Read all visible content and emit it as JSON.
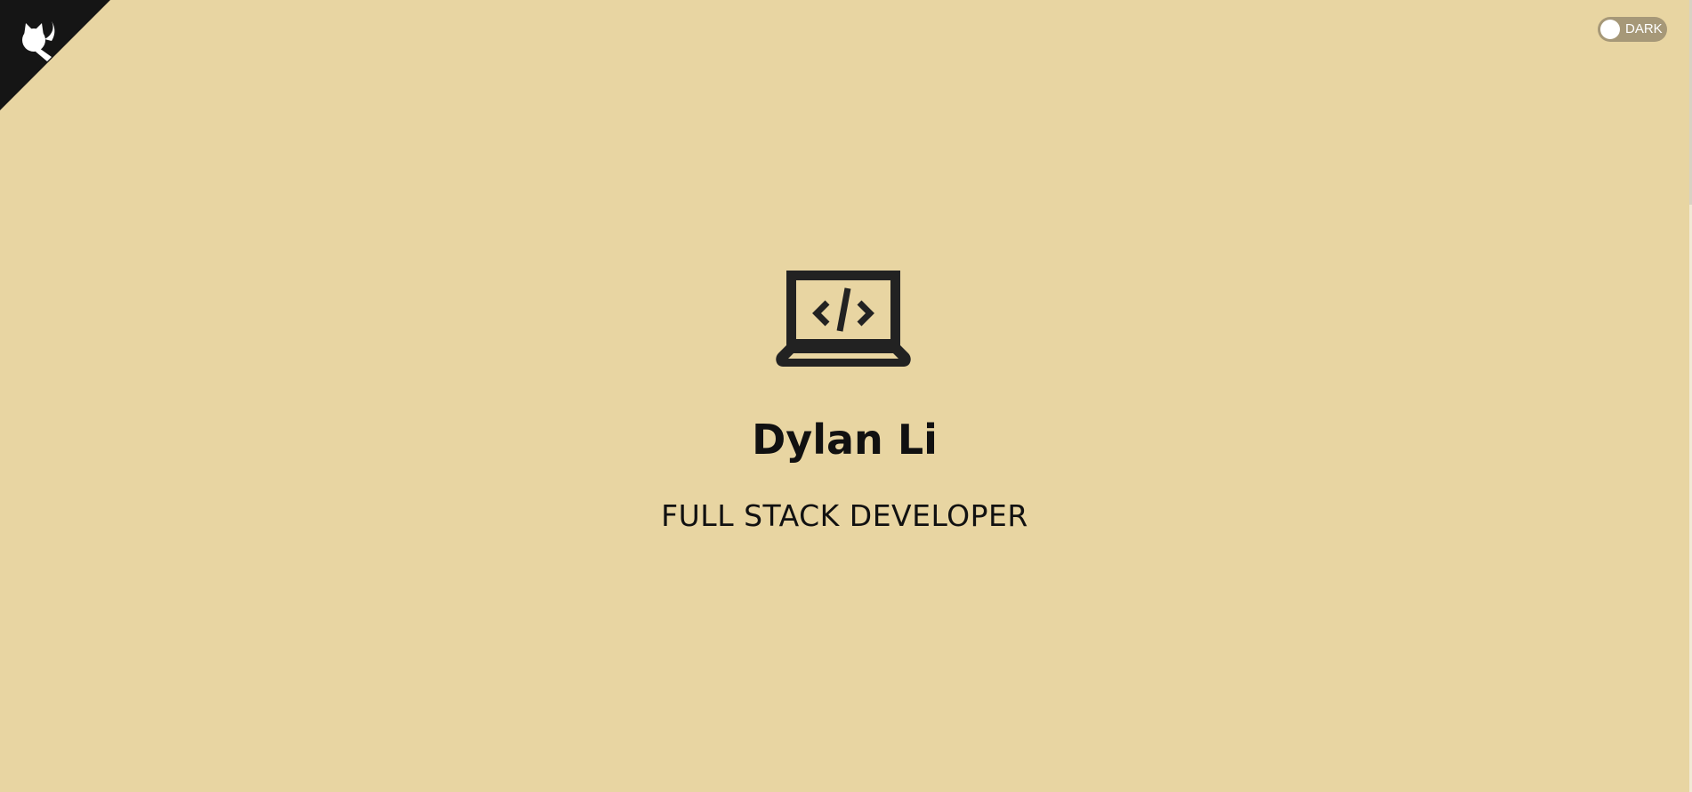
{
  "header": {
    "github_corner": {
      "icon": "github-octocat-icon"
    },
    "theme_toggle": {
      "label": "DARK",
      "state": "off"
    }
  },
  "hero": {
    "icon": "laptop-code-icon",
    "name": "Dylan Li",
    "title": "FULL STACK DEVELOPER"
  },
  "colors": {
    "background": "#e8d5a2",
    "text": "#111111",
    "icon": "#222222",
    "corner": "#151515",
    "toggle_track": "#a69878",
    "toggle_knob": "#ffffff"
  }
}
